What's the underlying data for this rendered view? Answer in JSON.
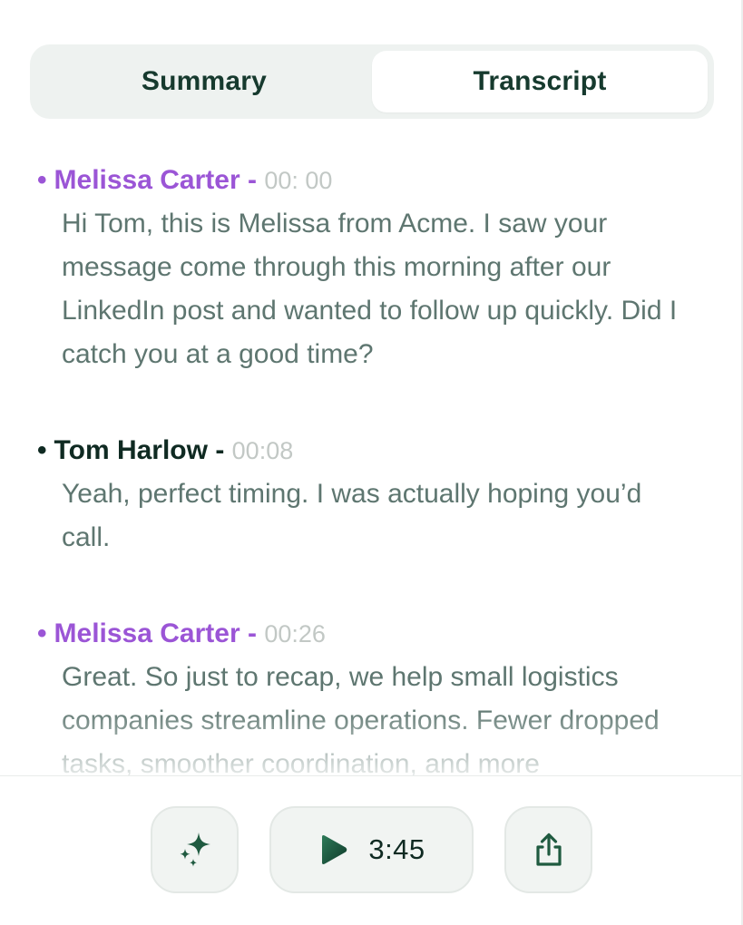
{
  "tabs": [
    {
      "label": "Summary",
      "active": false
    },
    {
      "label": "Transcript",
      "active": true
    }
  ],
  "transcript": [
    {
      "speaker": "Melissa Carter",
      "separator": "-",
      "time": "00: 00",
      "color": "#9b55d6",
      "text": "Hi Tom, this is Melissa from Acme. I saw your message come through this morning after our LinkedIn post and wanted to follow up quickly. Did I catch you at a good time?"
    },
    {
      "speaker": "Tom Harlow",
      "separator": "-",
      "time": "00:08",
      "color": "#0f2a22",
      "text": "Yeah, perfect timing. I was actually hoping you’d call."
    },
    {
      "speaker": "Melissa Carter",
      "separator": "-",
      "time": "00:26",
      "color": "#9b55d6",
      "text": "Great. So just to recap, we help small logistics companies streamline operations. Fewer dropped tasks, smoother coordination, and more"
    }
  ],
  "toolbar": {
    "ai_icon": "sparkles-icon",
    "play_icon": "play-icon",
    "duration": "3:45",
    "share_icon": "share-icon"
  },
  "colors": {
    "accent_dark": "#0f2a22",
    "speaker_purple": "#9b55d6",
    "body_text": "#5e7670",
    "muted_time": "#c2c8c5",
    "button_bg": "#f1f4f2"
  }
}
